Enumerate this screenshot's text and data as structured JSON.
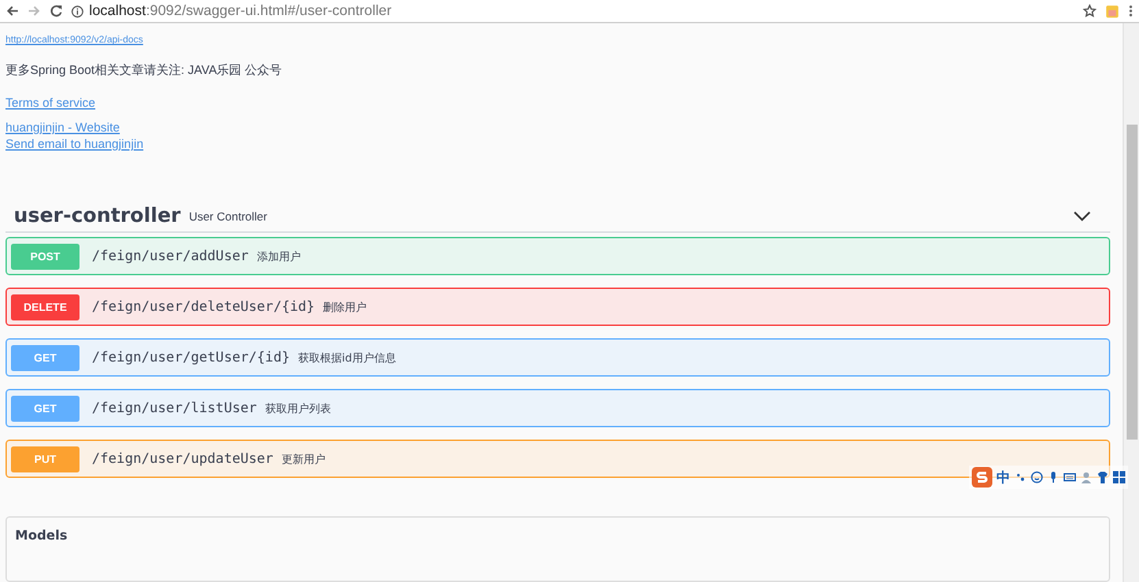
{
  "browser": {
    "url_host": "localhost",
    "url_rest": ":9092/swagger-ui.html#/user-controller"
  },
  "info": {
    "docs_link": "http://localhost:9092/v2/api-docs",
    "description": "更多Spring Boot相关文章请关注: JAVA乐园 公众号",
    "links": [
      "Terms of service",
      "huangjinjin - Website",
      "Send email to huangjinjin"
    ]
  },
  "tag": {
    "name": "user-controller",
    "description": "User Controller",
    "expanded": true
  },
  "operations": [
    {
      "method": "POST",
      "path": "/feign/user/addUser",
      "summary": "添加用户"
    },
    {
      "method": "DELETE",
      "path": "/feign/user/deleteUser/{id}",
      "summary": "删除用户"
    },
    {
      "method": "GET",
      "path": "/feign/user/getUser/{id}",
      "summary": "获取根据id用户信息"
    },
    {
      "method": "GET",
      "path": "/feign/user/listUser",
      "summary": "获取用户列表"
    },
    {
      "method": "PUT",
      "path": "/feign/user/updateUser",
      "summary": "更新用户"
    }
  ],
  "models": {
    "title": "Models"
  },
  "ime_toolbar": {
    "mode": "中"
  }
}
